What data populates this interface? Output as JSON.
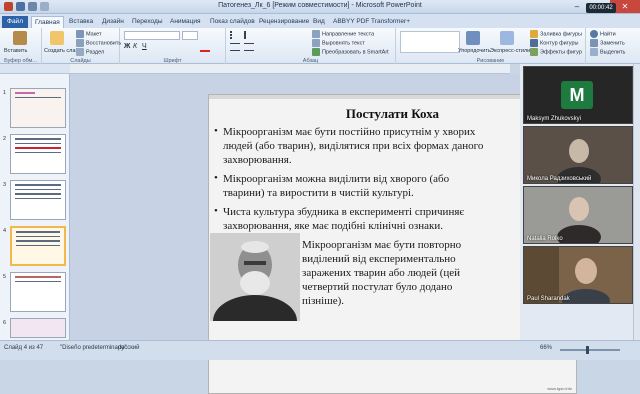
{
  "window": {
    "title": "Патогенез_Лк_6 [Режим совместимости] - Microsoft PowerPoint",
    "timer": "00:00:42",
    "minimize": "–",
    "maximize": "□",
    "close": "✕"
  },
  "tabs": [
    "Файл",
    "Главная",
    "Вставка",
    "Дизайн",
    "Переходы",
    "Анимация",
    "Показ слайдов",
    "Рецензирование",
    "Вид",
    "ABBYY PDF Transformer+"
  ],
  "ribbon": {
    "clipboard": {
      "paste": "Вставить",
      "label": "Буфер обм..."
    },
    "slides": {
      "new_slide": "Создать слайд",
      "layout": "Макет",
      "reset": "Восстановить",
      "section": "Раздел",
      "label": "Слайды"
    },
    "font": {
      "label": "Шрифт"
    },
    "paragraph": {
      "text_direction": "Направление текста",
      "align_text": "Выровнять текст",
      "convert_smartart": "Преобразовать в SmartArt",
      "label": "Абзац"
    },
    "drawing": {
      "arrange": "Упорядочить",
      "quick_styles": "Экспресс-стили",
      "shape_fill": "Заливка фигуры",
      "shape_outline": "Контур фигуры",
      "shape_effects": "Эффекты фигур",
      "label": "Рисование"
    },
    "editing": {
      "find": "Найти",
      "replace": "Заменить",
      "select": "Выделить",
      "label": "Редактирование"
    }
  },
  "slide_panel": {
    "numbers": [
      "1",
      "2",
      "3",
      "4",
      "5",
      "6"
    ],
    "selected": "4"
  },
  "slide": {
    "title": "Постулати Коха",
    "bullets": [
      "Мікроорганізм має бути постійно присутнім у хворих людей (або тварин), виділятися при всіх формах даного захворювання.",
      "Мікроорганізм можна виділити від хворого (або тварини) та виростити в чистій культурі.",
      "Чиста культура збудника в експерименті спричиняє захворювання, яке має подібні клінічні ознаки."
    ],
    "last_bullet": "Мікроорганізм має бути повторно виділений від експериментально заражених тварин або людей (цей четвертий постулат було додано пізніше).",
    "footnote": "www.tgsn.info"
  },
  "participants": [
    {
      "name": "Maksym Zhukovskyi",
      "initial": "M",
      "video": false
    },
    {
      "name": "Микола Радзиховський",
      "video": true
    },
    {
      "name": "Natalia Rolko",
      "video": true
    },
    {
      "name": "Paul Sharandak",
      "video": true
    }
  ],
  "status": {
    "slide_info": "Слайд 4 из 47",
    "theme": "\"Diseño predeterminado\"",
    "language": "русский",
    "zoom": "66%"
  }
}
